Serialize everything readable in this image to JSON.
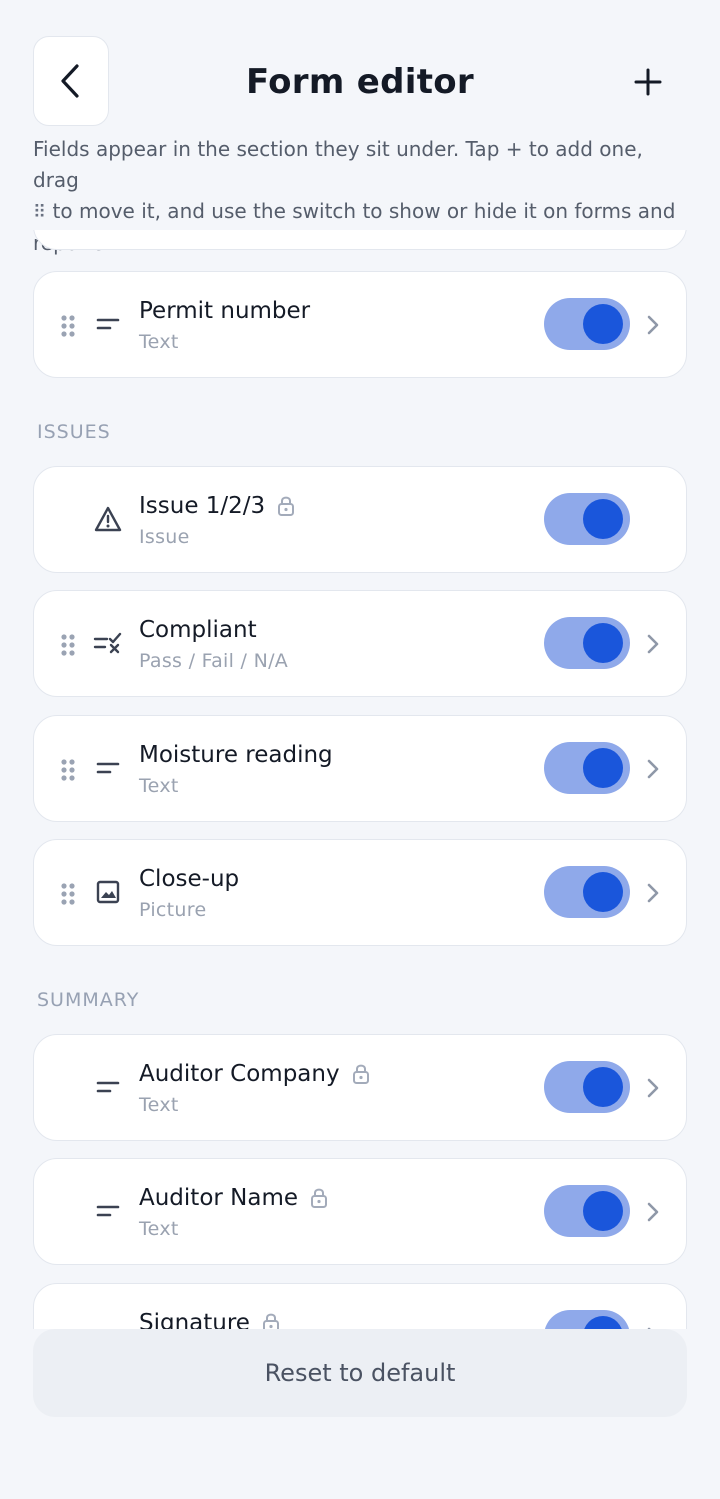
{
  "header": {
    "title": "Form editor"
  },
  "intro": {
    "part1": "Fields appear in the section they sit under. Tap + to add one, drag",
    "grip": "⠿",
    "part2": " to move it, and use the switch to show or hide it on forms and reports."
  },
  "fields_top": [
    {
      "name": "Permit number",
      "type": "Text",
      "icon": "text-lines-icon",
      "locked": false,
      "draggable": true,
      "visible": true
    }
  ],
  "sections": {
    "issues": "ISSUES",
    "summary": "SUMMARY"
  },
  "issues_fields": [
    {
      "name": "Issue 1/2/3",
      "type": "Issue",
      "icon": "warning-triangle-icon",
      "locked": true,
      "draggable": false,
      "visible": true
    },
    {
      "name": "Compliant",
      "type": "Pass / Fail / N/A",
      "icon": "pass-fail-icon",
      "locked": false,
      "draggable": true,
      "visible": true
    },
    {
      "name": "Moisture reading",
      "type": "Text",
      "icon": "text-lines-icon",
      "locked": false,
      "draggable": true,
      "visible": true
    },
    {
      "name": "Close-up",
      "type": "Picture",
      "icon": "picture-icon",
      "locked": false,
      "draggable": true,
      "visible": true
    }
  ],
  "summary_fields": [
    {
      "name": "Auditor Company",
      "type": "Text",
      "icon": "text-lines-icon",
      "locked": true,
      "draggable": false,
      "visible": true
    },
    {
      "name": "Auditor Name",
      "type": "Text",
      "icon": "text-lines-icon",
      "locked": true,
      "draggable": false,
      "visible": true
    },
    {
      "name": "Signature",
      "type": "",
      "icon": "signature-icon",
      "locked": true,
      "draggable": false,
      "visible": true
    }
  ],
  "footer": {
    "reset_label": "Reset to default"
  },
  "colors": {
    "toggle_track": "#8fa9ea",
    "toggle_knob": "#1a56db",
    "background": "#f4f6fa"
  }
}
